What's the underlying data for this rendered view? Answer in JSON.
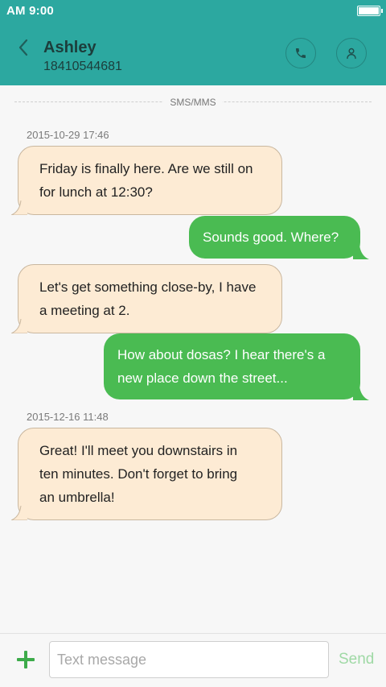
{
  "status_bar": {
    "time": "AM 9:00",
    "battery_icon": "battery-full-icon"
  },
  "header": {
    "contact_name": "Ashley",
    "contact_number": "18410544681",
    "back_icon": "back-chevron-icon",
    "call_icon": "phone-icon",
    "contact_icon": "person-icon",
    "background": "#2ca8a0"
  },
  "thread": {
    "channel_label": "SMS/MMS",
    "timestamps": [
      "2015-10-29 17:46",
      "2015-12-16 11:48"
    ],
    "messages": [
      {
        "direction": "incoming",
        "lines": [
          "Friday is finally here. Are we still on",
          "for lunch at 12:30?"
        ]
      },
      {
        "direction": "outgoing",
        "lines": [
          "Sounds good. Where?"
        ]
      },
      {
        "direction": "incoming",
        "lines": [
          "Let's get something close-by, I have",
          "a meeting at 2."
        ]
      },
      {
        "direction": "outgoing",
        "lines": [
          "How about dosas? I hear there's a",
          "new place down the street..."
        ]
      },
      {
        "direction": "incoming",
        "lines": [
          "Great! I'll meet you downstairs in",
          "ten minutes. Don't forget to bring",
          "an umbrella!"
        ]
      }
    ],
    "incoming_color": "#fdebd4",
    "outgoing_color": "#4abb52"
  },
  "composer": {
    "add_icon": "plus-icon",
    "input_value": "",
    "input_placeholder": "Text message",
    "send_label": "Send"
  }
}
